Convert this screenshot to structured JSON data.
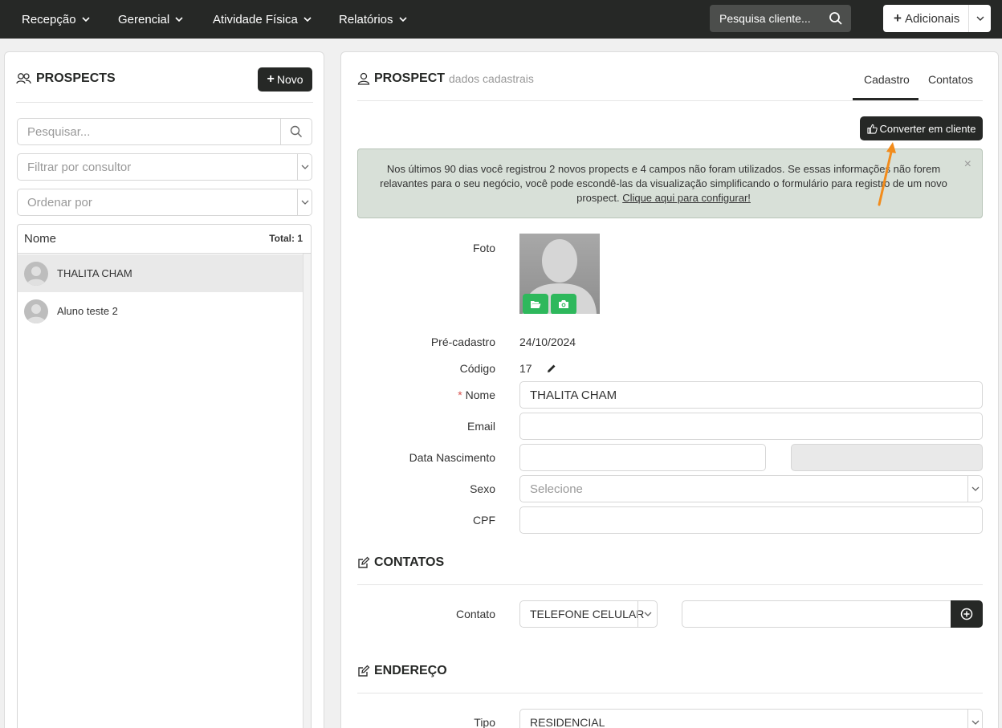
{
  "topnav": {
    "items": [
      {
        "label": "Recepção"
      },
      {
        "label": "Gerencial"
      },
      {
        "label": "Atividade Física"
      },
      {
        "label": "Relatórios"
      }
    ],
    "search_label": "Pesquisa cliente...",
    "add_label": "Adicionais"
  },
  "left": {
    "title": "PROSPECTS",
    "new_button": "Novo",
    "search_placeholder": "Pesquisar...",
    "filter_placeholder": "Filtrar por consultor",
    "order_placeholder": "Ordenar por",
    "list_header": "Nome",
    "total": "Total: 1",
    "items": [
      {
        "name": "THALITA CHAM"
      },
      {
        "name": "Aluno teste 2"
      }
    ]
  },
  "right": {
    "title": "PROSPECT",
    "subtitle": "dados cadastrais",
    "tabs": [
      "Cadastro",
      "Contatos"
    ],
    "convert_button": "Converter em cliente",
    "alert_text": "Nos últimos 90 dias você registrou 2 novos propects e 4 campos não foram utilizados. Se essas informações não forem relavantes para o seu negócio, você pode escondê-las da visualização simplificando o formulário para registro de um novo prospect. ",
    "alert_link": "Clique aqui para configurar!",
    "form": {
      "foto_label": "Foto",
      "pre_cadastro_label": "Pré-cadastro",
      "pre_cadastro_value": "24/10/2024",
      "codigo_label": "Código",
      "codigo_value": "17",
      "nome_label": "Nome",
      "nome_value": "THALITA CHAM",
      "email_label": "Email",
      "nascimento_label": "Data Nascimento",
      "sexo_label": "Sexo",
      "sexo_placeholder": "Selecione",
      "cpf_label": "CPF"
    },
    "contatos": {
      "title": "CONTATOS",
      "contato_label": "Contato",
      "contato_type": "TELEFONE CELULAR"
    },
    "endereco": {
      "title": "ENDEREÇO",
      "tipo_label": "Tipo",
      "tipo_value": "RESIDENCIAL"
    }
  },
  "colors": {
    "dark": "#262826",
    "accent_green": "#2eb85c",
    "alert_bg": "#d8e0d8",
    "annotation_arrow": "#f28c1c"
  }
}
